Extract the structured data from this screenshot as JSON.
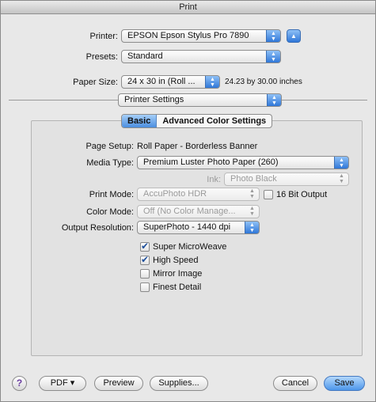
{
  "window": {
    "title": "Print"
  },
  "printer": {
    "label": "Printer:",
    "value": "EPSON Epson Stylus Pro 7890"
  },
  "presets": {
    "label": "Presets:",
    "value": "Standard"
  },
  "paper_size": {
    "label": "Paper Size:",
    "value": "24 x 30 in (Roll ...",
    "dimensions": "24.23 by 30.00 inches"
  },
  "panel": {
    "value": "Printer Settings"
  },
  "tabs": {
    "basic": "Basic",
    "advanced": "Advanced Color Settings"
  },
  "page_setup": {
    "label": "Page Setup:",
    "value": "Roll Paper - Borderless Banner"
  },
  "media_type": {
    "label": "Media Type:",
    "value": "Premium Luster Photo Paper (260)"
  },
  "ink": {
    "label": "Ink:",
    "value": "Photo Black"
  },
  "print_mode": {
    "label": "Print Mode:",
    "value": "AccuPhoto HDR",
    "bit_label": "16 Bit Output"
  },
  "color_mode": {
    "label": "Color Mode:",
    "value": "Off (No Color Manage..."
  },
  "output_resolution": {
    "label": "Output Resolution:",
    "value": "SuperPhoto - 1440 dpi"
  },
  "options": [
    {
      "label": "Super MicroWeave",
      "checked": true
    },
    {
      "label": "High Speed",
      "checked": true
    },
    {
      "label": "Mirror Image",
      "checked": false
    },
    {
      "label": "Finest Detail",
      "checked": false
    }
  ],
  "buttons": {
    "help": "?",
    "pdf": "PDF ▾",
    "preview": "Preview",
    "supplies": "Supplies...",
    "cancel": "Cancel",
    "save": "Save"
  }
}
